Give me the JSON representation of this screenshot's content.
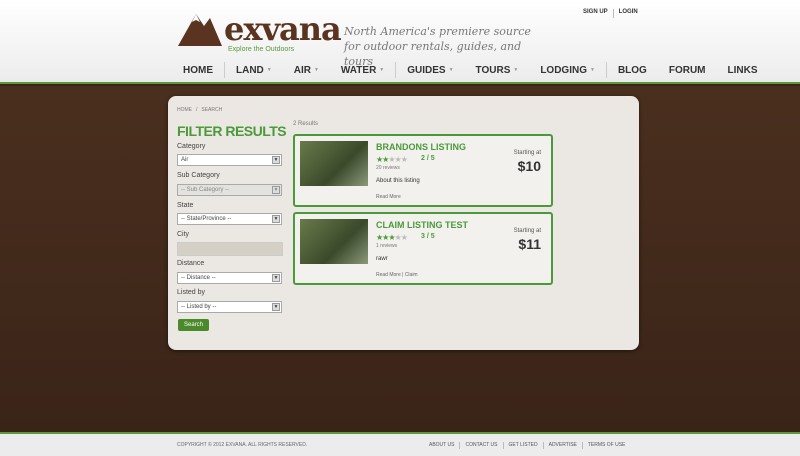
{
  "header": {
    "logo": {
      "name": "exvana",
      "tagline": "Explore the Outdoors"
    },
    "slogan": "North America's premiere source for outdoor rentals, guides, and tours",
    "top_links": [
      "SIGN UP",
      "LOGIN"
    ],
    "nav": [
      {
        "label": "HOME",
        "dropdown": false
      },
      {
        "label": "LAND",
        "dropdown": true
      },
      {
        "label": "AIR",
        "dropdown": true
      },
      {
        "label": "WATER",
        "dropdown": true
      },
      {
        "label": "GUIDES",
        "dropdown": true
      },
      {
        "label": "TOURS",
        "dropdown": true
      },
      {
        "label": "LODGING",
        "dropdown": true
      },
      {
        "label": "BLOG",
        "dropdown": false
      },
      {
        "label": "FORUM",
        "dropdown": false
      },
      {
        "label": "LINKS",
        "dropdown": false
      }
    ]
  },
  "breadcrumb": [
    "HOME",
    "SEARCH"
  ],
  "filter": {
    "title": "FILTER RESULTS",
    "category_label": "Category",
    "category_value": "Air",
    "subcategory_label": "Sub Category",
    "subcategory_value": "-- Sub Category --",
    "state_label": "State",
    "state_value": "-- State/Province --",
    "city_label": "City",
    "city_value": "",
    "distance_label": "Distance",
    "distance_value": "-- Distance --",
    "listedby_label": "Listed by",
    "listedby_value": "-- Listed by --",
    "search_button": "Search"
  },
  "results": {
    "count_text": "2 Results",
    "items": [
      {
        "title": "BRANDONS LISTING",
        "rating": "2 / 5",
        "reviews": "20 reviews",
        "description": "About this listing",
        "read_more": "Read More",
        "claim": "",
        "starting_at": "Starting at",
        "price": "$10"
      },
      {
        "title": "CLAIM LISTING TEST",
        "rating": "3 / 5",
        "reviews": "1 reviews",
        "description": "rawr",
        "read_more": "Read More",
        "claim": "Claim",
        "starting_at": "Starting at",
        "price": "$11"
      }
    ]
  },
  "footer": {
    "copyright": "COPYRIGHT © 2012 EXVANA. ALL RIGHTS RESERVED.",
    "links": [
      "ABOUT US",
      "CONTACT US",
      "GET LISTED",
      "ADVERTISE",
      "TERMS OF USE"
    ]
  },
  "colors": {
    "accent": "#4a9a3a",
    "brand_brown": "#5a3420",
    "background": "#3a2417"
  }
}
